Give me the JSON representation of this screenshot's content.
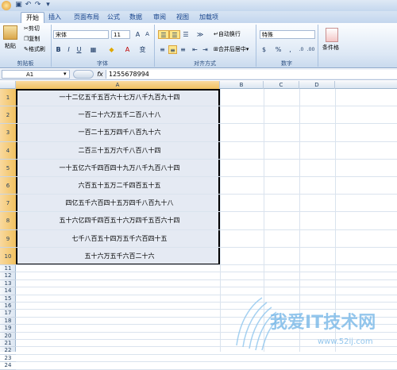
{
  "ribbon": {
    "tabs": [
      "开始",
      "插入",
      "页面布局",
      "公式",
      "数据",
      "审阅",
      "视图",
      "加载项"
    ],
    "active_tab": "开始",
    "clipboard": {
      "paste": "粘贴",
      "cut": "剪切",
      "copy": "复制",
      "format_painter": "格式刷",
      "label": "剪贴板"
    },
    "font": {
      "name": "宋体",
      "size": "11",
      "bold": "B",
      "italic": "I",
      "underline": "U",
      "label": "字体"
    },
    "alignment": {
      "wrap": "自动换行",
      "merge": "合并后居中",
      "label": "对齐方式"
    },
    "number": {
      "format": "特殊",
      "label": "数字"
    },
    "styles": {
      "conditional": "条件格"
    }
  },
  "formula_bar": {
    "name_box": "A1",
    "fx": "fx",
    "value": "1255678994"
  },
  "columns": [
    "A",
    "B",
    "C",
    "D"
  ],
  "rows": [
    "1",
    "2",
    "3",
    "4",
    "5",
    "6",
    "7",
    "8",
    "9",
    "10",
    "11",
    "12",
    "13",
    "14",
    "15",
    "16",
    "17",
    "18",
    "19",
    "20",
    "21",
    "22",
    "23",
    "24"
  ],
  "cells": [
    "一十二亿五千五百六十七万八千九百九十四",
    "一百二十六万五千二百八十八",
    "一百二十五万四千八百九十六",
    "二百三十五万六千八百八十四",
    "一十五亿六千四百四十九万八千九百八十四",
    "六百五十五万二千四百五十五",
    "四亿五千六百四十五万四千八百九十八",
    "五十六亿四千四百五十六万四千五百六十四",
    "七千八百五十四万五千六百四十五",
    "五十六万五千六百二十六"
  ],
  "colors": {
    "selection_fill": "#e5eaf3",
    "header_selected": "#f1c15f",
    "ribbon": "#dde8f5",
    "watermark": "#6fb3e6"
  },
  "watermark": {
    "text": "我爱IT技术网",
    "url": "www.52ij.com"
  }
}
